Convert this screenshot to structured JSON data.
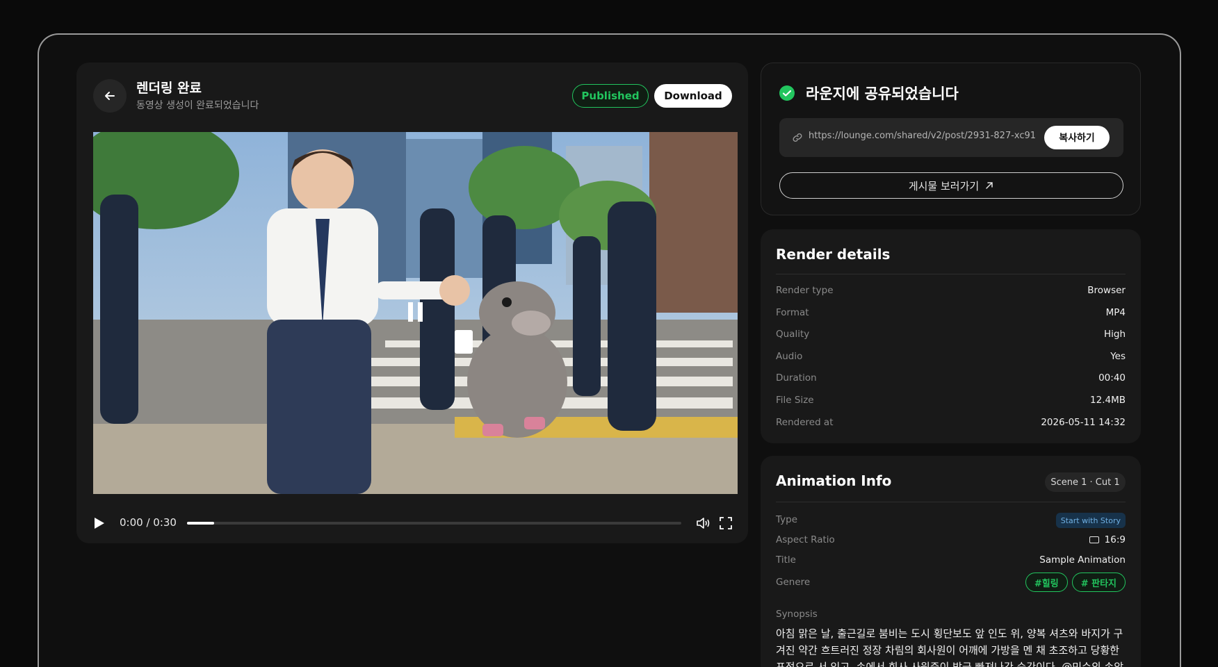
{
  "player": {
    "title": "렌더링 완료",
    "subtitle": "동영상 생성이 완료되었습니다",
    "published_label": "Published",
    "download_label": "Download",
    "time": "0:00 / 0:30",
    "progress": 0.055
  },
  "share": {
    "title": "라운지에 공유되었습니다",
    "url": "https://lounge.com/shared/v2/post/2931-827-xc91",
    "copy_label": "복사하기",
    "view_post_label": "게시물 보러가기"
  },
  "render": {
    "title": "Render details",
    "rows": [
      {
        "label": "Render type",
        "value": "Browser"
      },
      {
        "label": "Format",
        "value": "MP4"
      },
      {
        "label": "Quality",
        "value": "High"
      },
      {
        "label": "Audio",
        "value": "Yes"
      },
      {
        "label": "Duration",
        "value": "00:40"
      },
      {
        "label": "File Size",
        "value": "12.4MB"
      },
      {
        "label": "Rendered at",
        "value": "2026-05-11 14:32"
      }
    ]
  },
  "animation": {
    "title": "Animation Info",
    "scene_badge": "Scene 1 · Cut 1",
    "type_label": "Type",
    "type_value": "Start with Story",
    "aspect_label": "Aspect Ratio",
    "aspect_value": "16:9",
    "title_label": "Title",
    "title_value": "Sample Animation",
    "genre_label": "Genere",
    "tags": [
      "#힐링",
      "# 판타지"
    ],
    "synopsis_label": "Synopsis",
    "synopsis": "아침 맑은 날, 출근길로 붐비는 도시 횡단보도 앞 인도 위, 양복 셔츠와 바지가 구겨진 약간 흐트러진 정장 차림의 회사원이 어깨에 가방을 멘 채 초조하고 당황한 표정으로 서 있고, 손에서 회사 사원증이 방금 빠져나간 순간이다. @민수의 손앞에서 사"
  },
  "colors": {
    "accent_green": "#22c55e",
    "story_badge_bg": "#17324a",
    "story_badge_text": "#6fb0e3"
  }
}
